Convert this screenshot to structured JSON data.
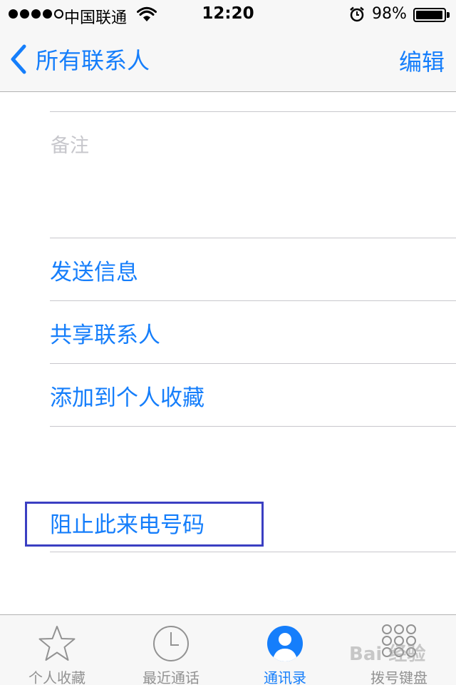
{
  "status_bar": {
    "carrier": "中国联通",
    "time": "12:20",
    "battery_percent": "98%",
    "battery_level": 0.98,
    "signal_bars_filled": 4,
    "signal_bars_total": 5
  },
  "nav": {
    "back_label": "所有联系人",
    "edit_label": "编辑"
  },
  "contact": {
    "notes_placeholder": "备注",
    "actions": [
      {
        "label": "发送信息"
      },
      {
        "label": "共享联系人"
      },
      {
        "label": "添加到个人收藏"
      }
    ],
    "block_label": "阻止此来电号码"
  },
  "tabbar": {
    "tabs": [
      {
        "label": "个人收藏",
        "icon": "star-icon"
      },
      {
        "label": "最近通话",
        "icon": "clock-icon"
      },
      {
        "label": "通讯录",
        "icon": "person-circle-icon",
        "active": true
      },
      {
        "label": "拨号键盘",
        "icon": "keypad-icon"
      }
    ]
  },
  "watermark": "Bai 经验",
  "colors": {
    "accent": "#157efb",
    "inactive": "#929292",
    "placeholder": "#c7c7cc",
    "highlight_box": "#3b3fc2"
  }
}
